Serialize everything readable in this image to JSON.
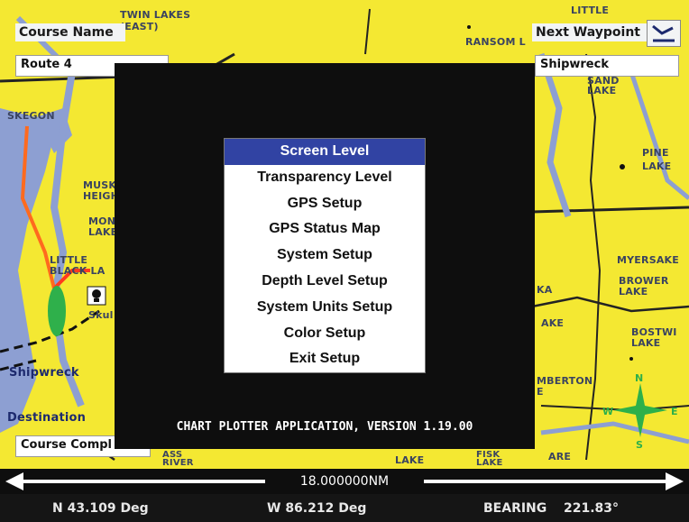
{
  "map": {
    "labels": [
      "TWIN LAKES\n(EAST)",
      "RANSOM L",
      "LITTLE",
      "SAND\nLAKE",
      "PINE\nLAKE",
      "SKEGON",
      "MUSK\nHEIGH",
      "MON\nLAKE",
      "LITTLE\nBLACK LA",
      "Skul",
      "MYERSAKE",
      "BROWER\nLAKE",
      "BOSTWI\nLAKE",
      "AKE",
      "KA",
      "MBERTON\nE",
      "ASS\nRIVER",
      "LAKE",
      "FISK\nLAKE",
      "ARE"
    ],
    "waypoint_labels": {
      "shipwreck": "Shipwreck",
      "destination": "Destination"
    },
    "colors": {
      "land": "#f4e832",
      "water": "#8d9fd2",
      "route": "#ff6a1e",
      "roads": "#232323"
    }
  },
  "panels": {
    "course_name_label": "Course Name",
    "course_name_value": "Route 4",
    "next_waypoint_label": "Next Waypoint",
    "next_waypoint_value": "Shipwreck",
    "course_complete_label": "Course Compl"
  },
  "menu": {
    "items": [
      {
        "label": "Screen Level",
        "selected": true
      },
      {
        "label": "Transparency Level"
      },
      {
        "label": "GPS Setup"
      },
      {
        "label": "GPS Status Map"
      },
      {
        "label": "System Setup"
      },
      {
        "label": "Depth Level Setup"
      },
      {
        "label": "System Units Setup"
      },
      {
        "label": "Color Setup"
      },
      {
        "label": "Exit Setup"
      }
    ],
    "selected_color": "#3143a3"
  },
  "footer": {
    "version": "CHART PLOTTER APPLICATION, VERSION 1.19.00",
    "scale": "18.000000NM",
    "lat": "N  43.109 Deg",
    "lon": "W  86.212 Deg",
    "bearing_label": "BEARING",
    "bearing_value": "221.83°"
  },
  "icons": [
    "route-toggle-icon",
    "compass-icon",
    "skull-waypoint-icon",
    "boat-position-icon"
  ]
}
